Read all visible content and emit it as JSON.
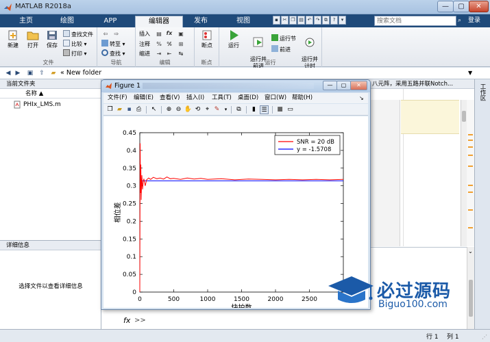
{
  "window": {
    "title": "MATLAB R2018a",
    "min_glyph": "—",
    "max_glyph": "▢",
    "close_glyph": "✕"
  },
  "ribbon_tabs": [
    {
      "label": "主页"
    },
    {
      "label": "绘图"
    },
    {
      "label": "APP"
    },
    {
      "label": "编辑器"
    },
    {
      "label": "发布"
    },
    {
      "label": "视图"
    }
  ],
  "search": {
    "placeholder": "搜索文档",
    "login_label": "登录"
  },
  "ribbon": {
    "file_group": {
      "label": "文件",
      "new": "新建",
      "open": "打开",
      "save": "保存",
      "find_files": "查找文件",
      "compare": "比较",
      "print": "打印"
    },
    "nav_group": {
      "label": "导航",
      "goto": "转至",
      "find": "查找"
    },
    "edit_group": {
      "label": "编辑",
      "insert": "插入",
      "comment": "注释",
      "indent": "缩进",
      "fx": "fx"
    },
    "breakpoint_group": {
      "label": "断点",
      "breakpoints": "断点"
    },
    "run_group": {
      "label": "运行",
      "run": "运行",
      "run_advance": "运行并\n前进",
      "run_section": "运行节",
      "advance": "前进",
      "run_time": "运行并\n计时"
    }
  },
  "address": {
    "path": "«  New folder"
  },
  "current_folder": {
    "title": "当前文件夹",
    "name_column": "名称 ▲",
    "files": [
      {
        "name": "PHIx_LMS.m"
      }
    ]
  },
  "details": {
    "title": "详细信息",
    "message": "选择文件以查看详细信息"
  },
  "editor": {
    "tab_text": "八元阵，采用五路并联Notch..."
  },
  "workspace": {
    "label": "工作区"
  },
  "command": {
    "prompt": "fx",
    "chevron": ">>"
  },
  "status": {
    "row_label": "行 1",
    "col_label": "列 1"
  },
  "figure": {
    "title": "Figure 1",
    "menus": [
      {
        "label": "文件(F)"
      },
      {
        "label": "编辑(E)"
      },
      {
        "label": "查看(V)"
      },
      {
        "label": "插入(I)"
      },
      {
        "label": "工具(T)"
      },
      {
        "label": "桌面(D)"
      },
      {
        "label": "窗口(W)"
      },
      {
        "label": "帮助(H)"
      }
    ]
  },
  "watermark": {
    "cn": "必过源码",
    "en": "Biguo100.com"
  },
  "chart_data": {
    "type": "line",
    "xlabel": "快拍数",
    "ylabel": "相位差",
    "xlim": [
      0,
      3000
    ],
    "ylim": [
      0,
      0.45
    ],
    "xticks": [
      0,
      500,
      1000,
      1500,
      2000,
      2500
    ],
    "yticks": [
      0,
      0.05,
      0.1,
      0.15,
      0.2,
      0.25,
      0.3,
      0.35,
      0.4,
      0.45
    ],
    "grid": false,
    "legend_position": "top-right",
    "series": [
      {
        "name": "SNR = 20 dB",
        "color": "#ff0000",
        "x": [
          0,
          5,
          10,
          15,
          20,
          25,
          30,
          40,
          50,
          60,
          80,
          100,
          130,
          160,
          200,
          250,
          300,
          350,
          400,
          450,
          500,
          600,
          700,
          800,
          900,
          1000,
          1200,
          1400,
          1600,
          1800,
          2000,
          2200,
          2400,
          2600,
          2800,
          3000
        ],
        "y": [
          0.0,
          0.42,
          0.28,
          0.36,
          0.26,
          0.3,
          0.33,
          0.29,
          0.31,
          0.32,
          0.3,
          0.317,
          0.322,
          0.318,
          0.324,
          0.32,
          0.322,
          0.319,
          0.325,
          0.32,
          0.321,
          0.318,
          0.322,
          0.319,
          0.321,
          0.318,
          0.32,
          0.317,
          0.319,
          0.318,
          0.317,
          0.318,
          0.317,
          0.318,
          0.317,
          0.318
        ]
      },
      {
        "name": "y = -1.5708",
        "color": "#0000ff",
        "x": [
          0,
          3000
        ],
        "y": [
          0.314,
          0.314
        ]
      }
    ]
  }
}
